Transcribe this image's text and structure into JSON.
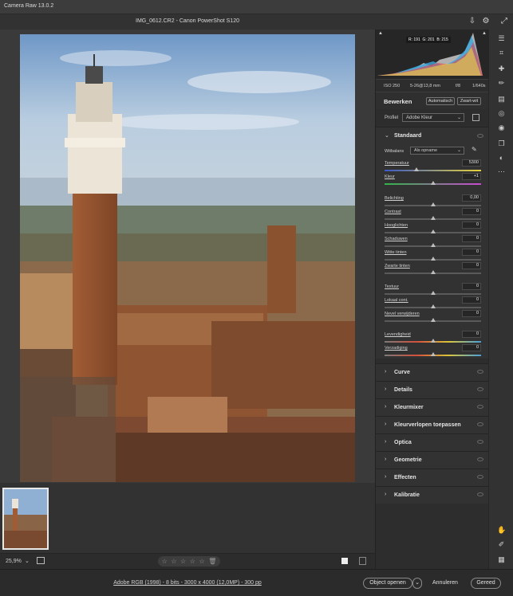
{
  "app": {
    "title": "Camera Raw 13.0.2"
  },
  "file": {
    "name": "IMG_0612.CR2",
    "camera": "Canon PowerShot S120"
  },
  "histogram": {
    "r": "R: 191",
    "g": "G: 201",
    "b": "B: 215"
  },
  "exif": {
    "iso": "ISO 250",
    "focal": "5-26@13,8 mm",
    "aperture": "f/8",
    "shutter": "1/640s"
  },
  "edit": {
    "title": "Bewerken",
    "auto": "Automatisch",
    "bw": "Zwart-wit"
  },
  "profile": {
    "label": "Profiel",
    "value": "Adobe Kleur"
  },
  "basic": {
    "title": "Standaard",
    "wb_label": "Witbalans",
    "wb_value": "Als opname",
    "sliders": [
      {
        "label": "Temperatuur",
        "value": "5300",
        "pos": 0.33
      },
      {
        "label": "Kleur",
        "value": "+1",
        "pos": 0.5
      },
      {
        "label": "Belichting",
        "value": "0,00",
        "pos": 0.5
      },
      {
        "label": "Contrast",
        "value": "0",
        "pos": 0.5
      },
      {
        "label": "Hooglichten",
        "value": "0",
        "pos": 0.5
      },
      {
        "label": "Schaduwen",
        "value": "0",
        "pos": 0.5
      },
      {
        "label": "Witte tinten",
        "value": "0",
        "pos": 0.5
      },
      {
        "label": "Zwarte tinten",
        "value": "0",
        "pos": 0.5
      },
      {
        "label": "Textuur",
        "value": "0",
        "pos": 0.5
      },
      {
        "label": "Lokaal cont.",
        "value": "0",
        "pos": 0.5
      },
      {
        "label": "Nevel verwijderen",
        "value": "0",
        "pos": 0.5
      },
      {
        "label": "Levendigheid",
        "value": "0",
        "pos": 0.5
      },
      {
        "label": "Verzadiging",
        "value": "0",
        "pos": 0.5
      }
    ]
  },
  "sections": [
    "Curve",
    "Details",
    "Kleurmixer",
    "Kleurverlopen toepassen",
    "Optica",
    "Geometrie",
    "Effecten",
    "Kalibratie"
  ],
  "bottom": {
    "zoom": "25,9%"
  },
  "footer": {
    "docinfo": "Adobe RGB (1998) - 8 bits - 3000 x 4000 (12,0MP) - 300 pp",
    "open": "Object openen",
    "cancel": "Annuleren",
    "done": "Gereed"
  }
}
